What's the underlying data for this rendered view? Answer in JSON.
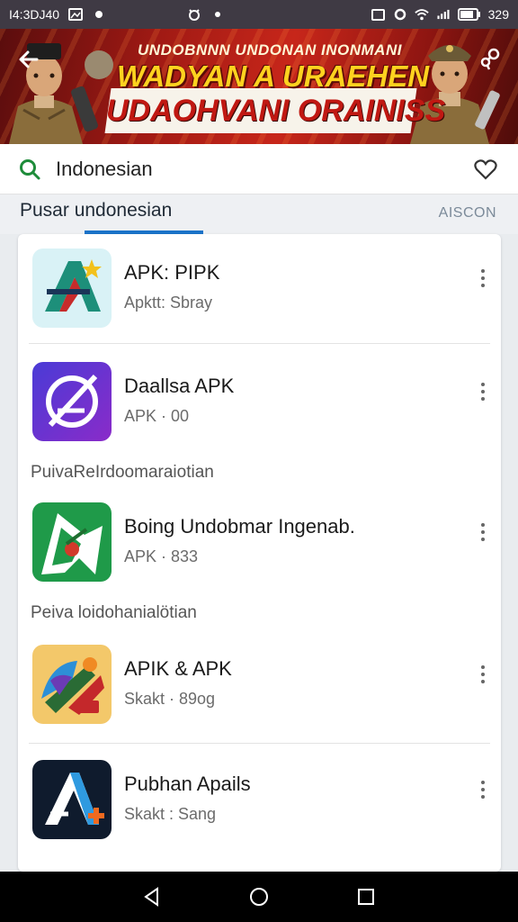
{
  "status_bar": {
    "time": "I4:3DJ40",
    "battery": "329"
  },
  "banner": {
    "line1": "UNDOBNNN UNDONAN INONMANI",
    "line2": "WADYAN A URAEHEN",
    "line3": "UDAOHVANI ORAINISS"
  },
  "search": {
    "value": "Indonesian"
  },
  "tabs": {
    "active_label": "Pusar  undonesian",
    "right_label": "AISCON"
  },
  "sections": {
    "label1": "PuivaReIrdoomaraiotian",
    "label2": "Peiva loidohanialötian"
  },
  "apps": [
    {
      "name": "APK: PIPK",
      "subtitle": "Apktt: Sbray"
    },
    {
      "name": "Daallsa APK",
      "subtitle": "APK · 00"
    },
    {
      "name": "Boing Undobmar Ingenab.",
      "subtitle": "APK · 833"
    },
    {
      "name": "APIK & APK",
      "subtitle": "Skakt · 89og"
    },
    {
      "name": "Pubhan Apails",
      "subtitle": "Skakt : Sang"
    }
  ],
  "icons": {
    "back": "back-arrow-icon",
    "share": "share-icon",
    "search": "search-icon",
    "favorite": "heart-icon",
    "more": "more-vertical-icon",
    "nav_back": "triangle-back-icon",
    "nav_home": "circle-home-icon",
    "nav_recents": "square-recents-icon"
  },
  "colors": {
    "accent": "#1a73c9",
    "status_bar": "#3f3a44",
    "banner_red": "#c7261a",
    "banner_yellow": "#ffd21f",
    "search_green": "#1e8c3a"
  }
}
